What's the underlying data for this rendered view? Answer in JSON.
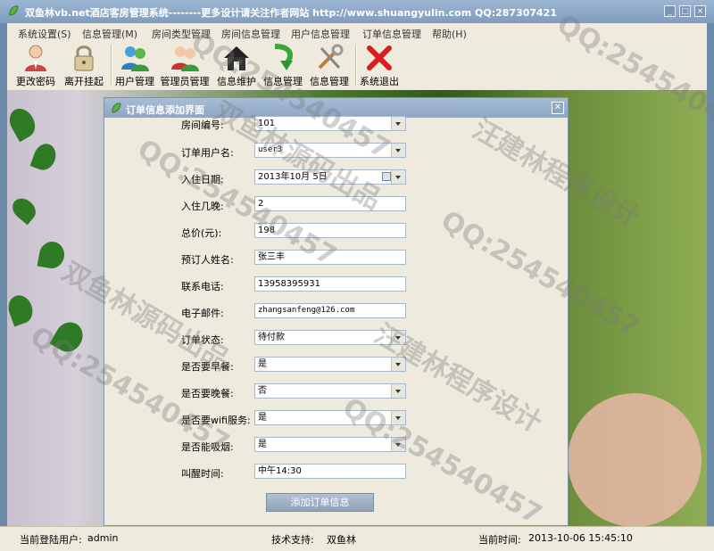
{
  "window": {
    "title": "双鱼林vb.net酒店客房管理系统--------更多设计请关注作者网站 http://www.shuangyulin.com  QQ:287307421",
    "controls": [
      "_",
      "□",
      "×"
    ]
  },
  "menu": [
    "系统设置(S)",
    "信息管理(M)",
    "房间类型管理",
    "房间信息管理",
    "用户信息管理",
    "订单信息管理",
    "帮助(H)"
  ],
  "toolbar": {
    "change_password": "更改密码",
    "lock": "离开挂起",
    "user_mgmt": "用户管理",
    "admin_mgmt": "管理员管理",
    "info_maint": "信息维护",
    "info_mgmt1": "信息管理",
    "info_mgmt2": "信息管理",
    "exit": "系统退出"
  },
  "dialog": {
    "title": "订单信息添加界面",
    "fields": [
      {
        "label": "房间编号:",
        "value": "101",
        "type": "select"
      },
      {
        "label": "订单用户名:",
        "value": "user3",
        "type": "select"
      },
      {
        "label": "入住日期:",
        "value": "2013年10月 5日",
        "type": "date"
      },
      {
        "label": "入住几晚:",
        "value": "2",
        "type": "text"
      },
      {
        "label": "总价(元):",
        "value": "198",
        "type": "text"
      },
      {
        "label": "预订人姓名:",
        "value": "张三丰",
        "type": "text"
      },
      {
        "label": "联系电话:",
        "value": "13958395931",
        "type": "text"
      },
      {
        "label": "电子邮件:",
        "value": "zhangsanfeng@126.com",
        "type": "text"
      },
      {
        "label": "订单状态:",
        "value": "待付款",
        "type": "select"
      },
      {
        "label": "是否要早餐:",
        "value": "是",
        "type": "select"
      },
      {
        "label": "是否要晚餐:",
        "value": "否",
        "type": "select"
      },
      {
        "label": "是否要wifi服务:",
        "value": "是",
        "type": "select"
      },
      {
        "label": "是否能吸烟:",
        "value": "是",
        "type": "select"
      },
      {
        "label": "叫醒时间:",
        "value": "中午14:30",
        "type": "text"
      }
    ],
    "submit_label": "添加订单信息"
  },
  "watermarks": [
    "QQ:254540457",
    "双鱼林源码出品",
    "汪建林程序设计"
  ],
  "status": {
    "user_label": "当前登陆用户:",
    "user": "admin",
    "support_label": "技术支持:",
    "support": "双鱼林",
    "time_label": "当前时间:",
    "time": "2013-10-06 15:45:10"
  }
}
